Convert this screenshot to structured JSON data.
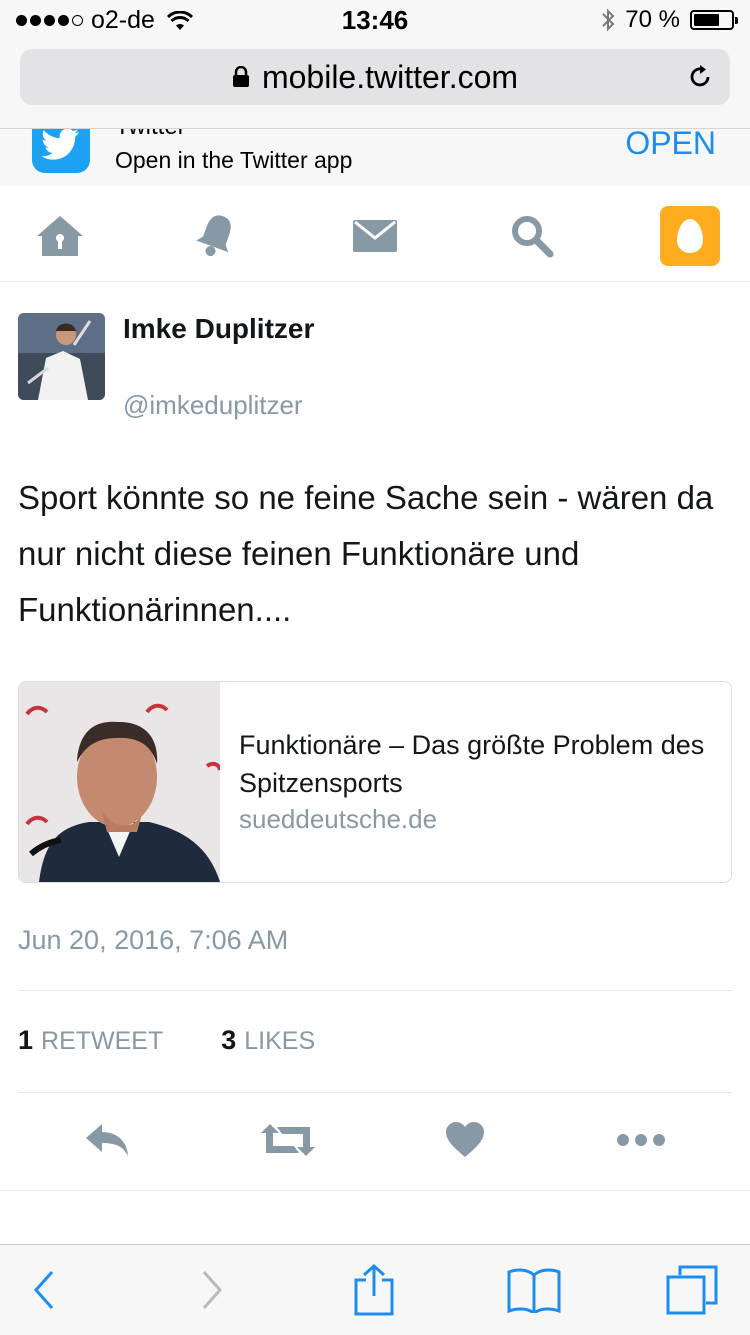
{
  "status": {
    "carrier": "o2-de",
    "time": "13:46",
    "battery": "70 %"
  },
  "browser": {
    "url": "mobile.twitter.com"
  },
  "banner": {
    "app_name": "Twitter",
    "subtitle": "Open in the Twitter app",
    "open_label": "OPEN"
  },
  "tweet": {
    "name": "Imke Duplitzer",
    "handle": "@imkeduplitzer",
    "text": "Sport könnte so ne feine Sache sein - wären da nur nicht diese feinen Funktionäre und Funktionärinnen....",
    "card": {
      "title": "Funktionäre – Das größte Problem des Spitzensports",
      "domain": "sueddeutsche.de"
    },
    "timestamp": "Jun 20, 2016, 7:06 AM",
    "stats": {
      "retweet_count": "1",
      "retweet_label": "RETWEET",
      "likes_count": "3",
      "likes_label": "LIKES"
    }
  },
  "colors": {
    "twitter_blue": "#1da1f2",
    "icon_gray": "#8899a6",
    "ios_blue": "#1d8cf0",
    "egg_orange": "#ffad1f"
  }
}
